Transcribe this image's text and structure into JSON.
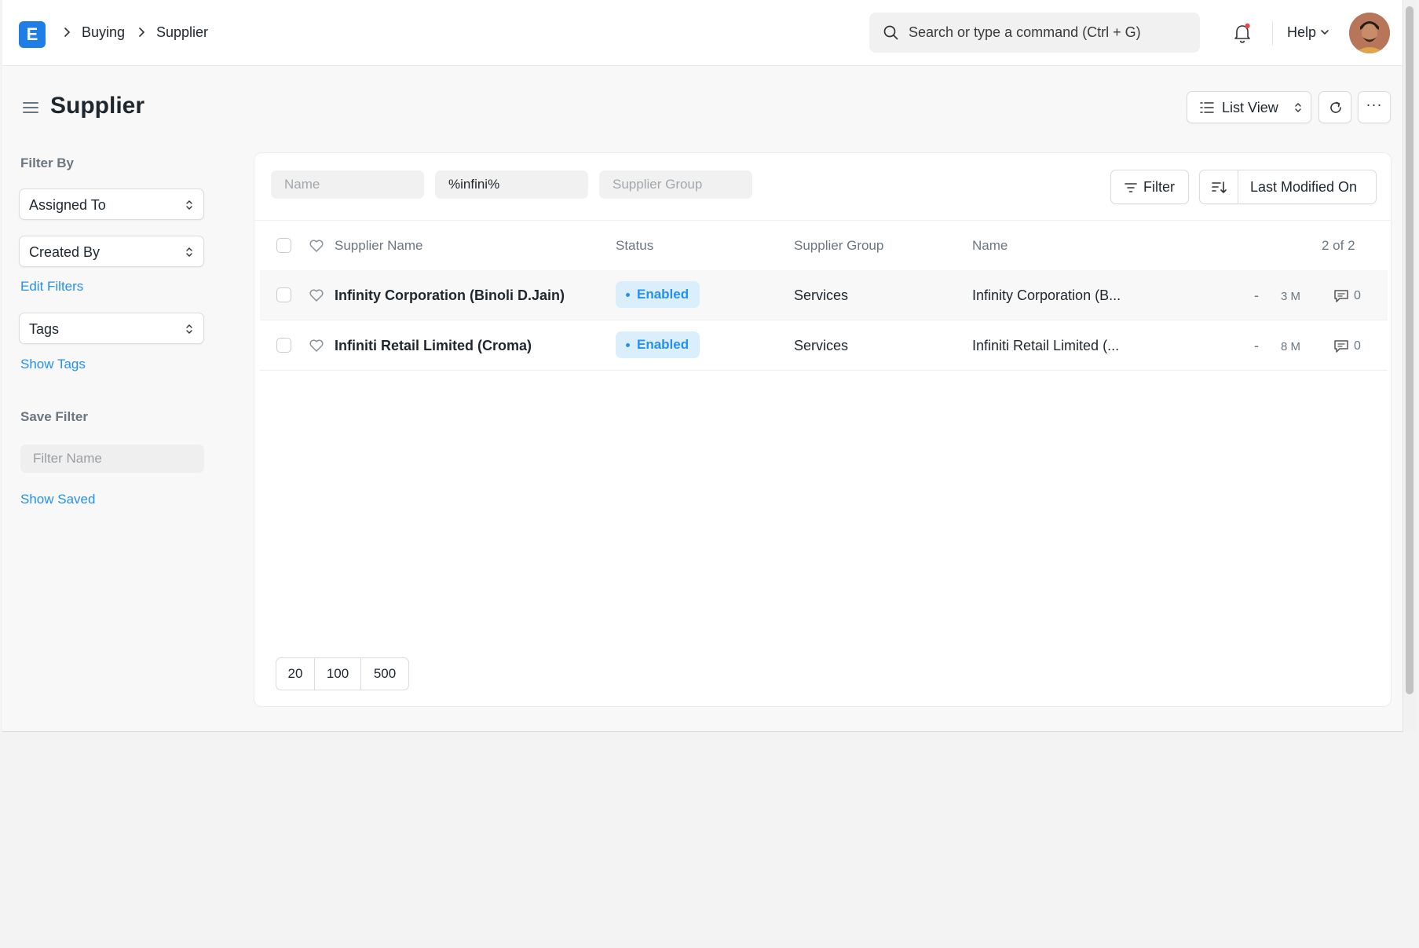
{
  "navbar": {
    "logo_letter": "E",
    "breadcrumbs": [
      "Buying",
      "Supplier"
    ],
    "search_placeholder": "Search or type a command (Ctrl + G)",
    "help_label": "Help"
  },
  "page": {
    "title": "Supplier",
    "list_view_label": "List View"
  },
  "sidebar": {
    "filter_by_label": "Filter By",
    "assigned_to": "Assigned To",
    "created_by": "Created By",
    "edit_filters": "Edit Filters",
    "tags": "Tags",
    "show_tags": "Show Tags",
    "save_filter_label": "Save Filter",
    "filter_name_placeholder": "Filter Name",
    "show_saved": "Show Saved"
  },
  "filters": {
    "name_placeholder": "Name",
    "search_value": "%infini%",
    "supplier_group_placeholder": "Supplier Group",
    "filter_button": "Filter",
    "sort_label": "Last Modified On"
  },
  "table": {
    "columns": {
      "supplier_name": "Supplier Name",
      "status": "Status",
      "supplier_group": "Supplier Group",
      "name": "Name",
      "count": "2 of 2"
    },
    "rows": [
      {
        "supplier_name": "Infinity Corporation (Binoli D.Jain)",
        "status": "Enabled",
        "supplier_group": "Services",
        "name": "Infinity Corporation (B...",
        "dash": "-",
        "age": "3 M",
        "comments": "0"
      },
      {
        "supplier_name": "Infiniti Retail Limited (Croma)",
        "status": "Enabled",
        "supplier_group": "Services",
        "name": "Infiniti Retail Limited (...",
        "dash": "-",
        "age": "8 M",
        "comments": "0"
      }
    ]
  },
  "paging": [
    "20",
    "100",
    "500"
  ],
  "colors": {
    "accent": "#2490ef",
    "logo": "#1f7ee5",
    "status_bg": "#dbeefc",
    "notification_dot": "#e24c4c"
  }
}
